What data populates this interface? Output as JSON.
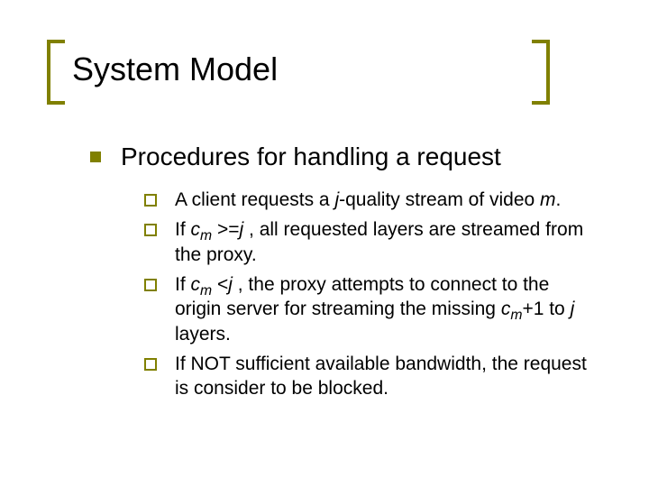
{
  "title": "System Model",
  "heading": "Procedures for handling a request",
  "items": {
    "i0": {
      "a": "A client requests a ",
      "j": "j",
      "b": "-quality stream of video ",
      "m": "m",
      "c": "."
    },
    "i1": {
      "a": "If ",
      "c": "c",
      "m": "m",
      "b": " >=",
      "j": "j",
      "d": " , all requested layers are streamed from the proxy."
    },
    "i2": {
      "a": "If ",
      "c": "c",
      "m": "m",
      "b": " <",
      "j": "j",
      "d": " , the proxy attempts to connect to the origin server for streaming the missing ",
      "c2": "c",
      "m2": "m",
      "e": "+1 to ",
      "j2": "j",
      "f": " layers."
    },
    "i3": {
      "a": "If NOT sufficient available bandwidth, the request is consider to be blocked."
    }
  }
}
